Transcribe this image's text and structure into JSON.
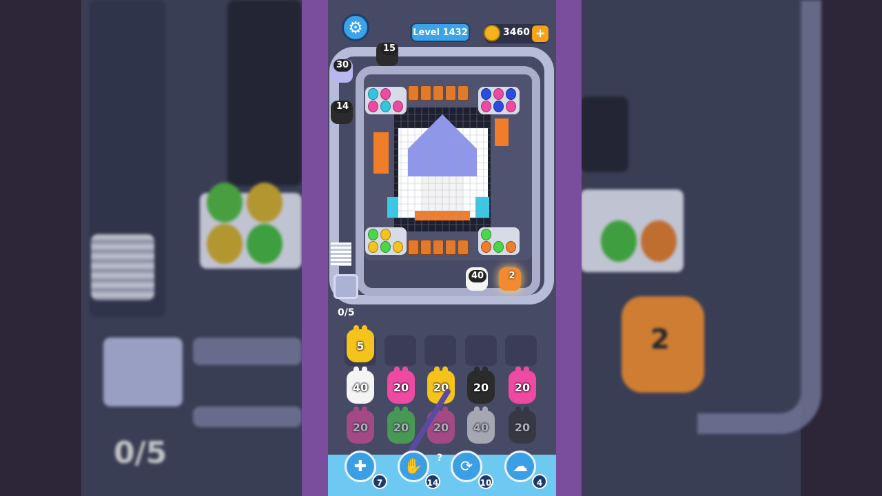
{
  "header": {
    "level_label": "Level 1432",
    "coins": "3460",
    "coin_plus": "+"
  },
  "track_shooters": [
    {
      "count": "15",
      "color": "#2b2b2b"
    },
    {
      "count": "30",
      "color": "#b9b6f0"
    },
    {
      "count": "14",
      "color": "#2b2b2b"
    },
    {
      "count": "40",
      "color": "#f4f4f4"
    },
    {
      "count": "2",
      "color": "#f28a2e"
    }
  ],
  "queue_counter": "0/5",
  "slots": [
    {
      "count": "5",
      "color": "#f6c21c"
    }
  ],
  "grid": {
    "row1": [
      {
        "count": "40",
        "color": "#f4f4f4"
      },
      {
        "count": "20",
        "color": "#ef4aa3"
      },
      {
        "count": "20",
        "color": "#f6c21c"
      },
      {
        "count": "20",
        "color": "#2b2b2b"
      },
      {
        "count": "20",
        "color": "#ef4aa3"
      }
    ],
    "row2": [
      {
        "count": "20",
        "color": "#ef4aa3"
      },
      {
        "count": "20",
        "color": "#4ad84a"
      },
      {
        "count": "20",
        "color": "#ef4aa3"
      },
      {
        "count": "40",
        "color": "#f4f4f4"
      },
      {
        "count": "20",
        "color": "#2b2b2b"
      }
    ]
  },
  "powerups": [
    {
      "name": "add-slot",
      "count": "7"
    },
    {
      "name": "hand",
      "count": "14"
    },
    {
      "name": "shuffle",
      "count": "10"
    },
    {
      "name": "rabbit",
      "count": "4"
    }
  ],
  "hidden_label": "?",
  "background_zoom": {
    "counter": "0/5",
    "shooter_count": "2"
  }
}
